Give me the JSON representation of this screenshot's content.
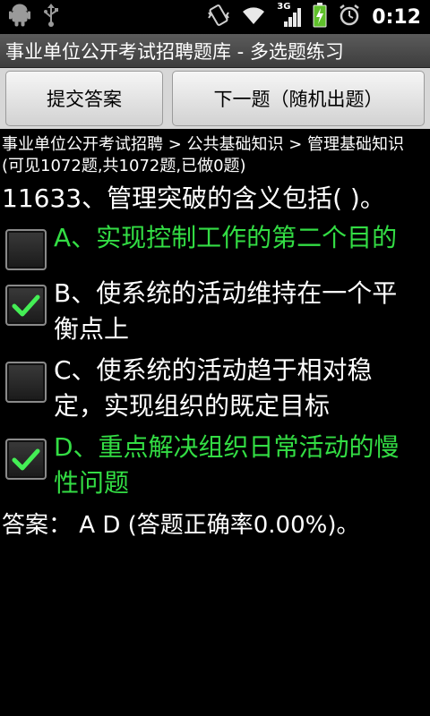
{
  "status": {
    "time": "0:12",
    "network_label": "3G"
  },
  "title": "事业单位公开考试招聘题库 - 多选题练习",
  "buttons": {
    "submit": "提交答案",
    "next": "下一题（随机出题）"
  },
  "breadcrumb": "事业单位公开考试招聘 > 公共基础知识 > 管理基础知识 (可见1072题,共1072题,已做0题)",
  "question": "11633、管理突破的含义包括(   )。",
  "options": [
    {
      "text": "A、实现控制工作的第二个目的",
      "checked": false,
      "highlight": true
    },
    {
      "text": "B、使系统的活动维持在一个平衡点上",
      "checked": true,
      "highlight": false
    },
    {
      "text": "C、使系统的活动趋于相对稳定，实现组织的既定目标",
      "checked": false,
      "highlight": false
    },
    {
      "text": "D、重点解决组织日常活动的慢性问题",
      "checked": true,
      "highlight": true
    }
  ],
  "answer": "答案： A D (答题正确率0.00%)。",
  "colors": {
    "correct": "#33dd44",
    "check": "#44ee55"
  }
}
